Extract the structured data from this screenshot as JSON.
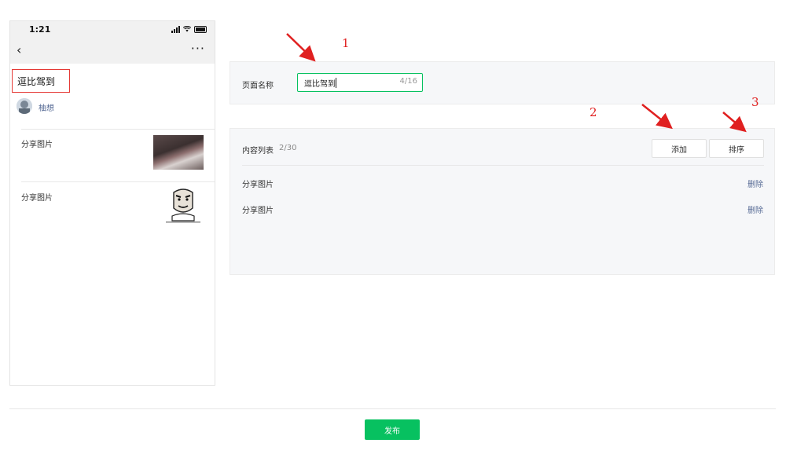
{
  "phone": {
    "time": "1:21",
    "back_glyph": "‹",
    "more_glyph": "···",
    "page_title": "逗比驾到",
    "author": "柚想",
    "items": [
      {
        "title": "分享图片"
      },
      {
        "title": "分享图片"
      }
    ]
  },
  "form": {
    "page_name_label": "页面名称",
    "page_name_value": "逗比驾到",
    "page_name_counter": "4/16"
  },
  "content": {
    "list_label": "内容列表",
    "list_count": "2/30",
    "add_label": "添加",
    "sort_label": "排序",
    "rows": [
      {
        "title": "分享图片",
        "delete_label": "删除"
      },
      {
        "title": "分享图片",
        "delete_label": "删除"
      }
    ]
  },
  "annotations": {
    "n1": "1",
    "n2": "2",
    "n3": "3",
    "arrow_color": "#e02020"
  },
  "footer": {
    "publish_label": "发布"
  },
  "colors": {
    "accent": "#07c160",
    "link": "#576b95",
    "highlight_border": "#e53935"
  }
}
